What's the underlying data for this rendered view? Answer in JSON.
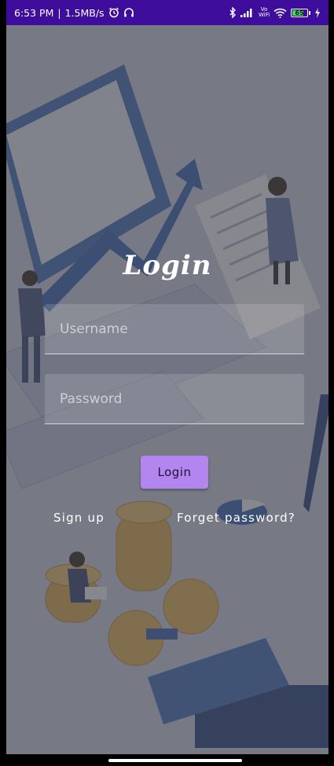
{
  "status_bar": {
    "time": "6:53 PM",
    "separator": "|",
    "speed": "1.5MB/s",
    "battery_level": "65",
    "icons": [
      "alarm-icon",
      "headset-icon",
      "bluetooth-icon",
      "signal-icon",
      "vowifi-icon",
      "wifi-icon",
      "battery-icon",
      "charging-icon"
    ],
    "vowifi_text": "Vo WiFi"
  },
  "login": {
    "title": "Login",
    "username_placeholder": "Username",
    "password_placeholder": "Password",
    "button_label": "Login",
    "signup_label": "Sign up",
    "forget_label": "Forget password?"
  },
  "colors": {
    "status_bar": "#3e0d9b",
    "button": "#b385ee",
    "overlay": "#46464c"
  }
}
